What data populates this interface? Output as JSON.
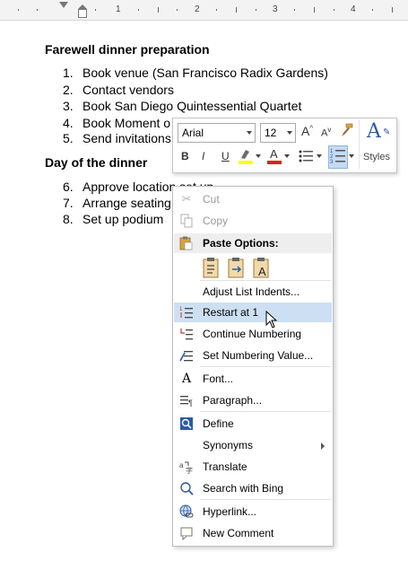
{
  "ruler": {
    "numbers": [
      "1",
      "2",
      "3",
      "4"
    ]
  },
  "document": {
    "heading1": "Farewell dinner preparation",
    "list1": [
      {
        "num": "1.",
        "text": "Book venue (San Francisco Radix Gardens)"
      },
      {
        "num": "2.",
        "text": "Contact vendors"
      },
      {
        "num": "3.",
        "text": "Book San Diego Quintessential Quartet"
      },
      {
        "num": "4.",
        "text": "Book Moment o"
      },
      {
        "num": "5.",
        "text": "Send invitations"
      }
    ],
    "heading2": "Day of the dinner",
    "list2": [
      {
        "num": "6.",
        "text": "Approve location set up"
      },
      {
        "num": "7.",
        "text": "Arrange seating"
      },
      {
        "num": "8.",
        "text": "Set up podium"
      }
    ]
  },
  "mini_toolbar": {
    "font": "Arial",
    "size": "12",
    "grow_font": "A",
    "shrink_font": "A",
    "bold": "B",
    "italic": "I",
    "underline": "U",
    "font_color": "A",
    "styles_label": "Styles",
    "colors": {
      "font_color": "#e02020",
      "highlight": "#ffff00",
      "accent": "#2a5aa8"
    }
  },
  "context_menu": {
    "cut": "Cut",
    "copy": "Copy",
    "paste_options": "Paste Options:",
    "adjust_list_indents": "Adjust List Indents...",
    "restart_at_1": "Restart at 1",
    "continue_numbering": "Continue Numbering",
    "set_numbering_value": "Set Numbering Value...",
    "font": "Font...",
    "paragraph": "Paragraph...",
    "define": "Define",
    "synonyms": "Synonyms",
    "translate": "Translate",
    "search_with_bing": "Search with Bing",
    "hyperlink": "Hyperlink...",
    "new_comment": "New Comment"
  }
}
